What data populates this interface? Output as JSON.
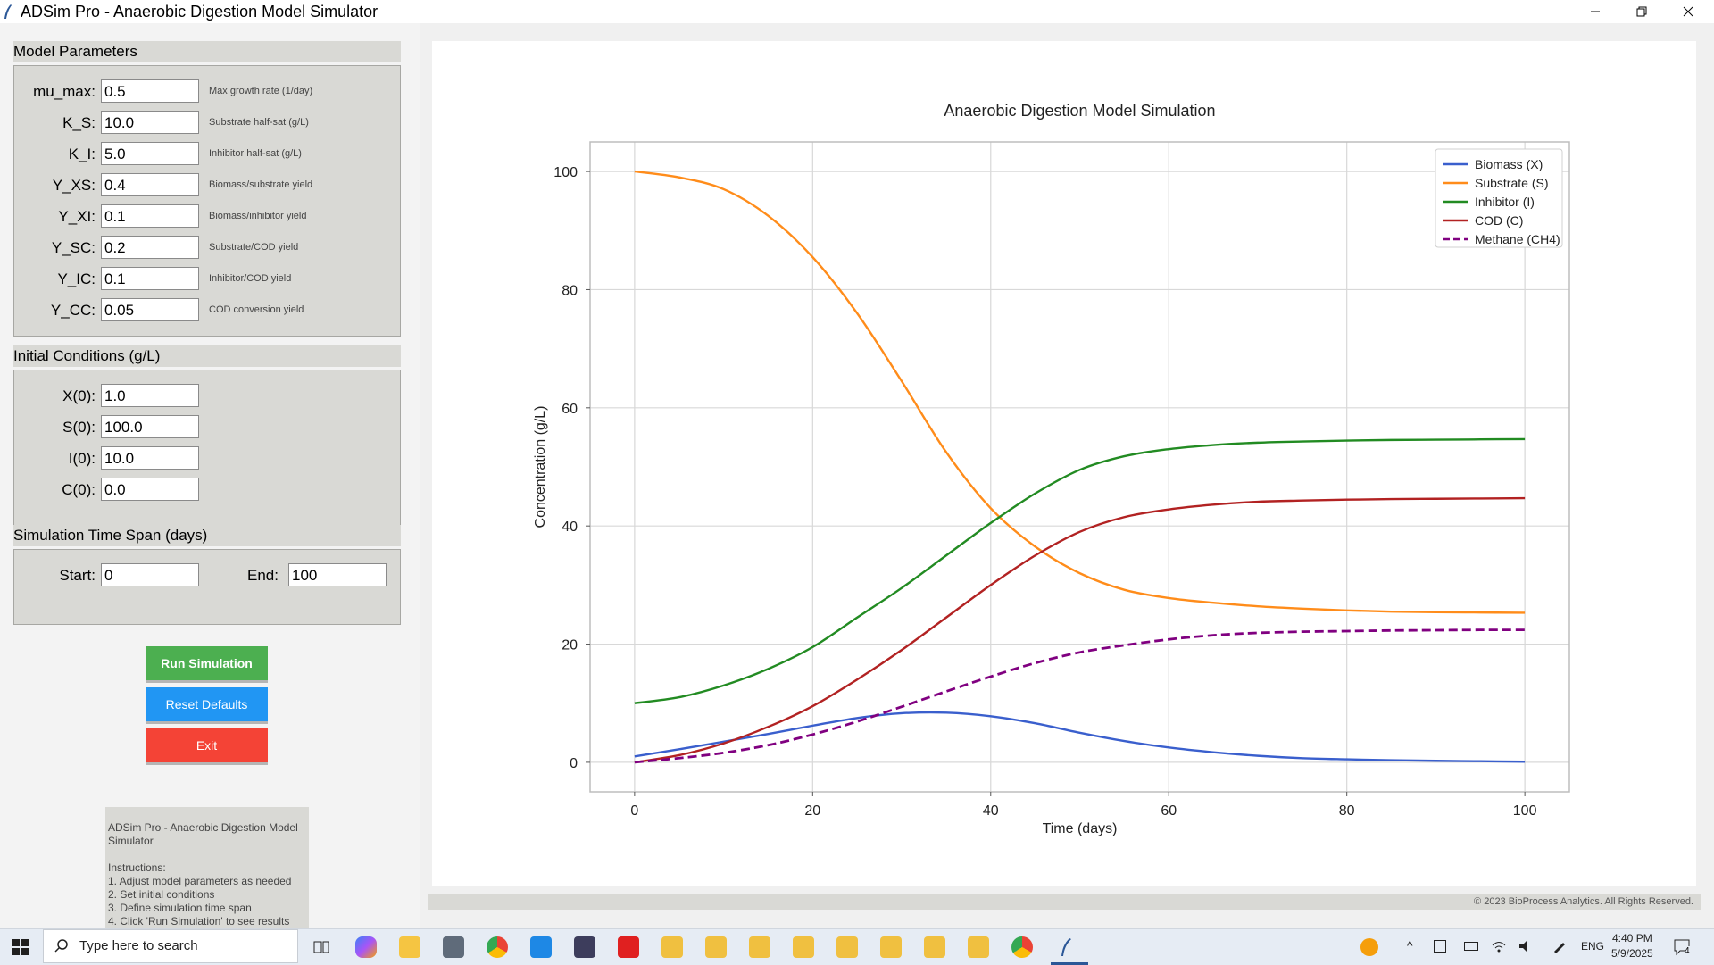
{
  "window": {
    "title": "ADSim Pro - Anaerobic Digestion Model Simulator"
  },
  "model_parameters": {
    "header": "Model Parameters",
    "params": [
      {
        "label": "mu_max:",
        "value": "0.5",
        "desc": "Max growth rate (1/day)"
      },
      {
        "label": "K_S:",
        "value": "10.0",
        "desc": "Substrate half-sat (g/L)"
      },
      {
        "label": "K_I:",
        "value": "5.0",
        "desc": "Inhibitor half-sat (g/L)"
      },
      {
        "label": "Y_XS:",
        "value": "0.4",
        "desc": "Biomass/substrate yield"
      },
      {
        "label": "Y_XI:",
        "value": "0.1",
        "desc": "Biomass/inhibitor yield"
      },
      {
        "label": "Y_SC:",
        "value": "0.2",
        "desc": "Substrate/COD yield"
      },
      {
        "label": "Y_IC:",
        "value": "0.1",
        "desc": "Inhibitor/COD yield"
      },
      {
        "label": "Y_CC:",
        "value": "0.05",
        "desc": "COD conversion yield"
      }
    ]
  },
  "initial_conditions": {
    "header": "Initial Conditions (g/L)",
    "fields": [
      {
        "label": "X(0):",
        "value": "1.0"
      },
      {
        "label": "S(0):",
        "value": "100.0"
      },
      {
        "label": "I(0):",
        "value": "10.0"
      },
      {
        "label": "C(0):",
        "value": "0.0"
      }
    ]
  },
  "time_span": {
    "header": "Simulation Time Span (days)",
    "start_label": "Start:",
    "start_value": "0",
    "end_label": "End:",
    "end_value": "100"
  },
  "buttons": {
    "run": "Run Simulation",
    "reset": "Reset Defaults",
    "exit": "Exit"
  },
  "info": {
    "text": "ADSim Pro - Anaerobic Digestion Model\nSimulator\n\nInstructions:\n1. Adjust model parameters as needed\n2. Set initial conditions\n3. Define simulation time span\n4. Click 'Run Simulation' to see results"
  },
  "status": {
    "copyright": "© 2023 BioProcess Analytics. All Rights Reserved."
  },
  "taskbar": {
    "search_placeholder": "Type here to search",
    "language": "ENG",
    "time": "4:40 PM",
    "date": "5/9/2025",
    "notifications": "4"
  },
  "chart_data": {
    "type": "line",
    "title": "Anaerobic Digestion Model Simulation",
    "xlabel": "Time (days)",
    "ylabel": "Concentration (g/L)",
    "xlim": [
      -5,
      105
    ],
    "ylim": [
      -5,
      105
    ],
    "xticks": [
      0,
      20,
      40,
      60,
      80,
      100
    ],
    "yticks": [
      0,
      20,
      40,
      60,
      80,
      100
    ],
    "grid": true,
    "legend_position": "top-right",
    "x": [
      0,
      5,
      10,
      15,
      20,
      25,
      30,
      35,
      40,
      45,
      50,
      55,
      60,
      65,
      70,
      75,
      80,
      85,
      90,
      95,
      100
    ],
    "series": [
      {
        "name": "Biomass (X)",
        "color": "#3a5fcd",
        "dash": false,
        "values": [
          1.0,
          2.2,
          3.5,
          4.8,
          6.2,
          7.5,
          8.3,
          8.4,
          7.8,
          6.6,
          5.0,
          3.6,
          2.5,
          1.7,
          1.1,
          0.7,
          0.5,
          0.35,
          0.25,
          0.18,
          0.1
        ]
      },
      {
        "name": "Substrate (S)",
        "color": "#ff8c1a",
        "dash": false,
        "values": [
          100,
          99.0,
          97.0,
          92.5,
          85.5,
          76.0,
          64.5,
          52.5,
          43.0,
          36.5,
          32.0,
          29.2,
          27.8,
          27.0,
          26.4,
          26.0,
          25.7,
          25.5,
          25.4,
          25.35,
          25.3
        ]
      },
      {
        "name": "Inhibitor (I)",
        "color": "#228b22",
        "dash": false,
        "values": [
          10,
          11.0,
          13.0,
          15.8,
          19.5,
          24.5,
          29.5,
          35.0,
          40.5,
          45.5,
          49.5,
          51.8,
          53.0,
          53.7,
          54.1,
          54.3,
          54.45,
          54.55,
          54.6,
          54.65,
          54.7
        ]
      },
      {
        "name": "COD (C)",
        "color": "#b22222",
        "dash": false,
        "values": [
          0,
          1.2,
          3.2,
          6.0,
          9.5,
          14.0,
          19.0,
          24.5,
          30.0,
          35.0,
          39.0,
          41.5,
          42.8,
          43.6,
          44.1,
          44.3,
          44.45,
          44.55,
          44.6,
          44.65,
          44.7
        ]
      },
      {
        "name": "Methane (CH4)",
        "color": "#800080",
        "dash": true,
        "values": [
          0,
          0.7,
          1.6,
          2.9,
          4.7,
          6.9,
          9.4,
          12.0,
          14.5,
          16.8,
          18.6,
          19.8,
          20.8,
          21.5,
          21.9,
          22.1,
          22.2,
          22.3,
          22.35,
          22.4,
          22.4
        ]
      }
    ]
  }
}
